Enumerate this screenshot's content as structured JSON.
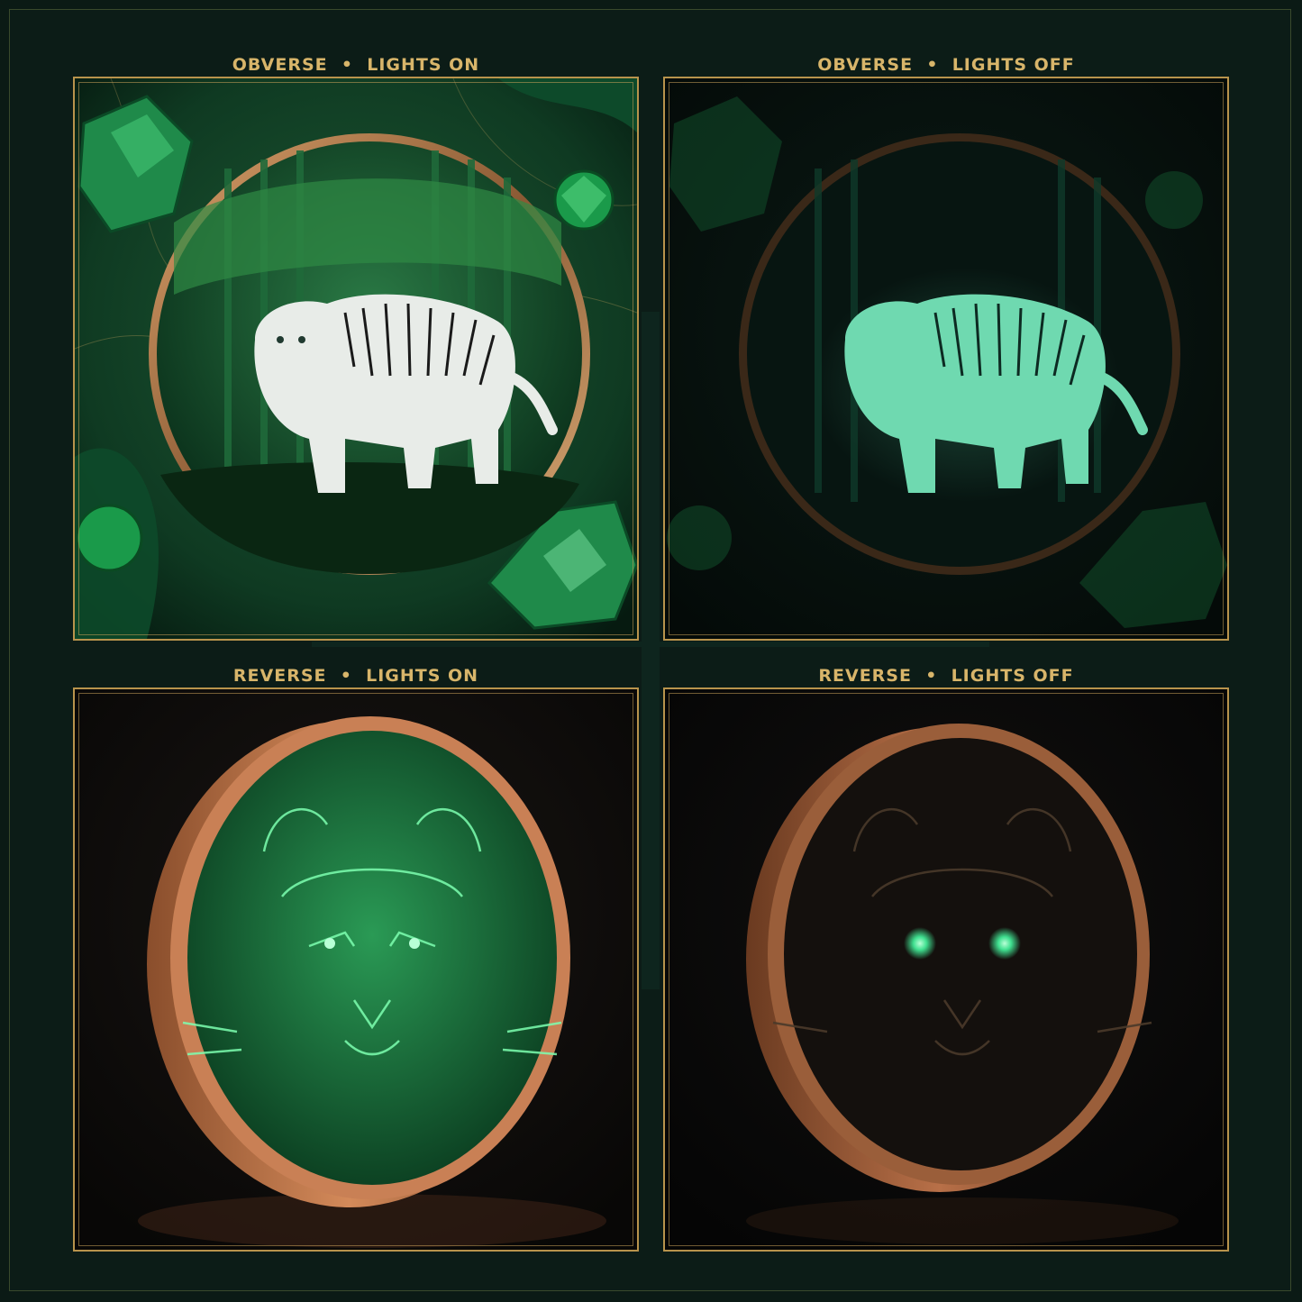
{
  "panels": [
    {
      "title": "OBVERSE  •  LIGHTS ON"
    },
    {
      "title": "OBVERSE  •  LIGHTS OFF"
    },
    {
      "title": "REVERSE  •  LIGHTS ON"
    },
    {
      "title": "REVERSE  •  LIGHTS OFF"
    }
  ],
  "colors": {
    "background": "#0b1a15",
    "frame_gold": "#b8934c",
    "title_gold": "#d8b56a",
    "emerald": "#1f7a3e",
    "glow": "#5fe3b0",
    "copper": "#c07a4a"
  }
}
